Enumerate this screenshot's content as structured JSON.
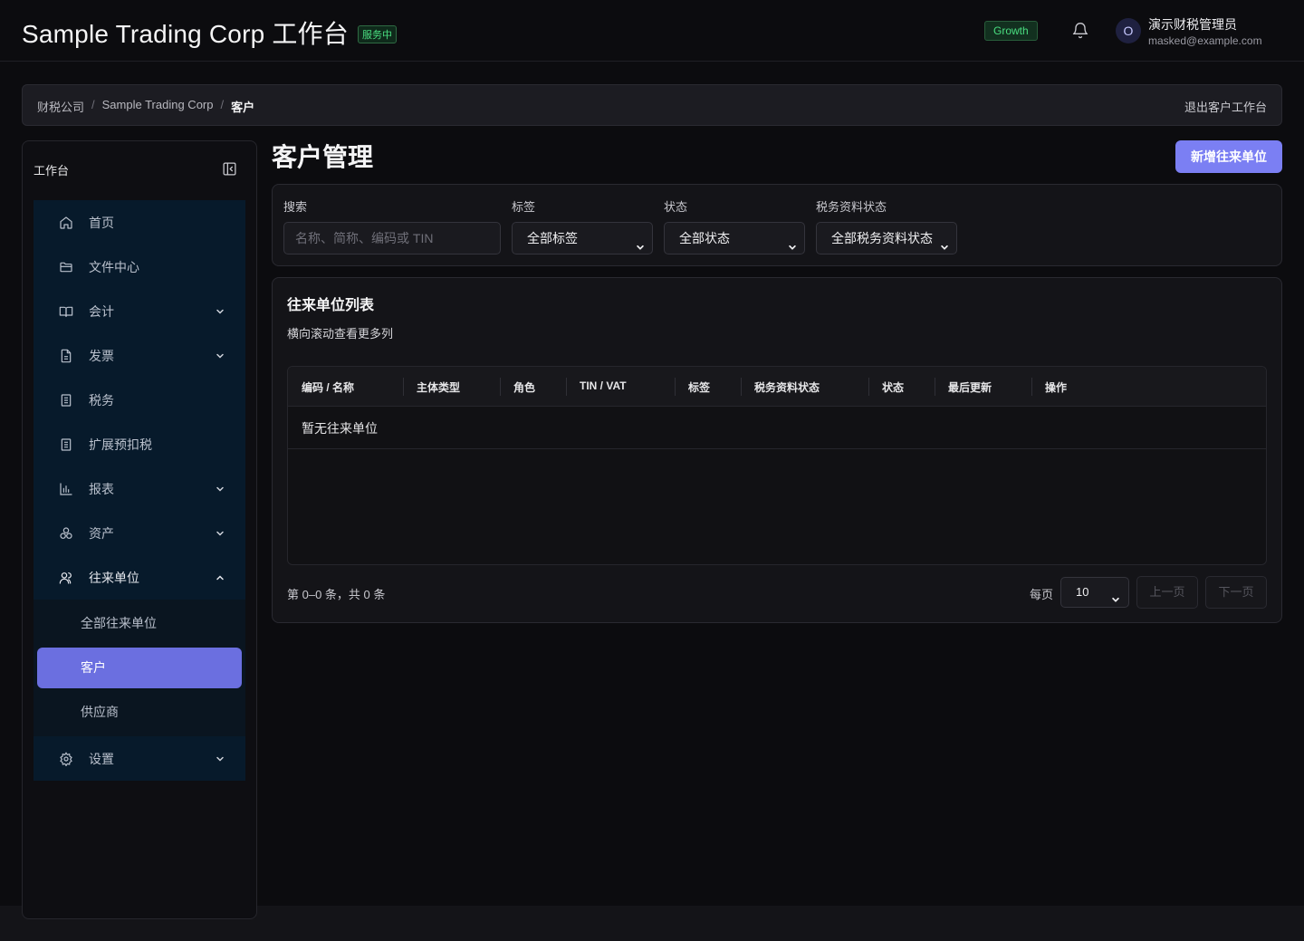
{
  "header": {
    "title": "Sample Trading Corp 工作台",
    "service_badge": "服务中",
    "plan_badge": "Growth",
    "user_initial": "O",
    "user_name": "演示财税管理员",
    "user_email": "masked@example.com"
  },
  "breadcrumb": {
    "items": [
      "财税公司",
      "Sample Trading Corp",
      "客户"
    ],
    "separator": "/",
    "exit_label": "退出客户工作台"
  },
  "sidebar": {
    "title": "工作台",
    "items": [
      {
        "label": "首页",
        "icon": "home-icon",
        "expandable": false
      },
      {
        "label": "文件中心",
        "icon": "folder-icon",
        "expandable": false
      },
      {
        "label": "会计",
        "icon": "book-icon",
        "expandable": true
      },
      {
        "label": "发票",
        "icon": "file-icon",
        "expandable": true
      },
      {
        "label": "税务",
        "icon": "document-icon",
        "expandable": false
      },
      {
        "label": "扩展预扣税",
        "icon": "document-icon",
        "expandable": false
      },
      {
        "label": "报表",
        "icon": "bar-chart-icon",
        "expandable": true
      },
      {
        "label": "资产",
        "icon": "assets-icon",
        "expandable": true
      },
      {
        "label": "往来单位",
        "icon": "users-icon",
        "expandable": true,
        "open": true
      }
    ],
    "subitems": [
      {
        "label": "全部往来单位",
        "active": false
      },
      {
        "label": "客户",
        "active": true
      },
      {
        "label": "供应商",
        "active": false
      }
    ],
    "settings_label": "设置"
  },
  "main": {
    "page_title": "客户管理",
    "add_button": "新增往来单位"
  },
  "filters": {
    "search_label": "搜索",
    "search_placeholder": "名称、简称、编码或 TIN",
    "tag_label": "标签",
    "tag_value": "全部标签",
    "status_label": "状态",
    "status_value": "全部状态",
    "tax_label": "税务资料状态",
    "tax_value": "全部税务资料状态"
  },
  "table": {
    "title": "往来单位列表",
    "subtitle": "横向滚动查看更多列",
    "columns": [
      "编码 / 名称",
      "主体类型",
      "角色",
      "TIN / VAT",
      "标签",
      "税务资料状态",
      "状态",
      "最后更新",
      "操作"
    ],
    "empty_text": "暂无往来单位"
  },
  "pagination": {
    "info": "第 0–0 条，共 0 条",
    "per_page_label": "每页",
    "page_size": "10",
    "prev": "上一页",
    "next": "下一页"
  },
  "colors": {
    "accent": "#7b7ff3",
    "active_nav": "#6b6fe0",
    "success": "#4ade80",
    "nav_bg": "#071a2b"
  }
}
